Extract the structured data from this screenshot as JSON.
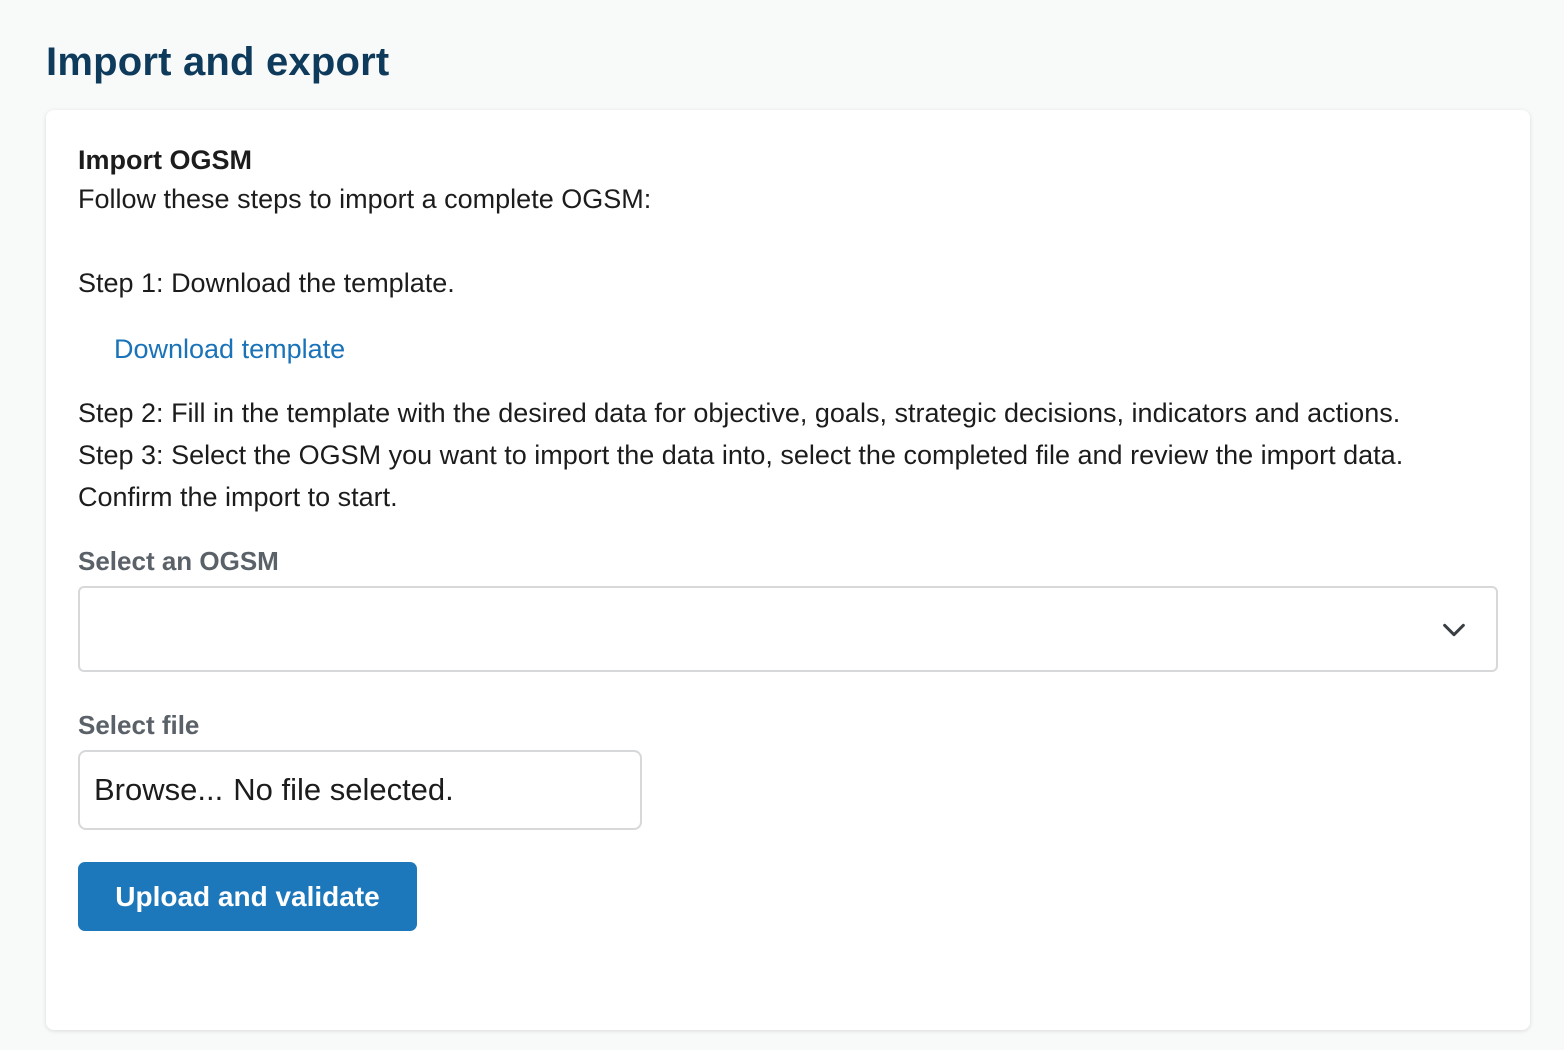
{
  "page": {
    "title": "Import and export"
  },
  "import_section": {
    "title": "Import OGSM",
    "intro": "Follow these steps to import a complete OGSM:",
    "step1": "Step 1: Download the template.",
    "download_link": "Download template",
    "step2": "Step 2: Fill in the template with the desired data for objective, goals, strategic decisions, indicators and actions.",
    "step3": "Step 3: Select the OGSM you want to import the data into, select the completed file and review the import data. Confirm the import to start."
  },
  "form": {
    "ogsm_label": "Select an OGSM",
    "ogsm_selected": "",
    "file_label": "Select file",
    "file_browse": "Browse...",
    "file_status": "No file selected.",
    "submit_label": "Upload and validate"
  },
  "icons": {
    "select_chevron": "chevron-down-icon"
  },
  "colors": {
    "title": "#0e3a5c",
    "link": "#1a73b8",
    "primary_button": "#1d77bb"
  }
}
